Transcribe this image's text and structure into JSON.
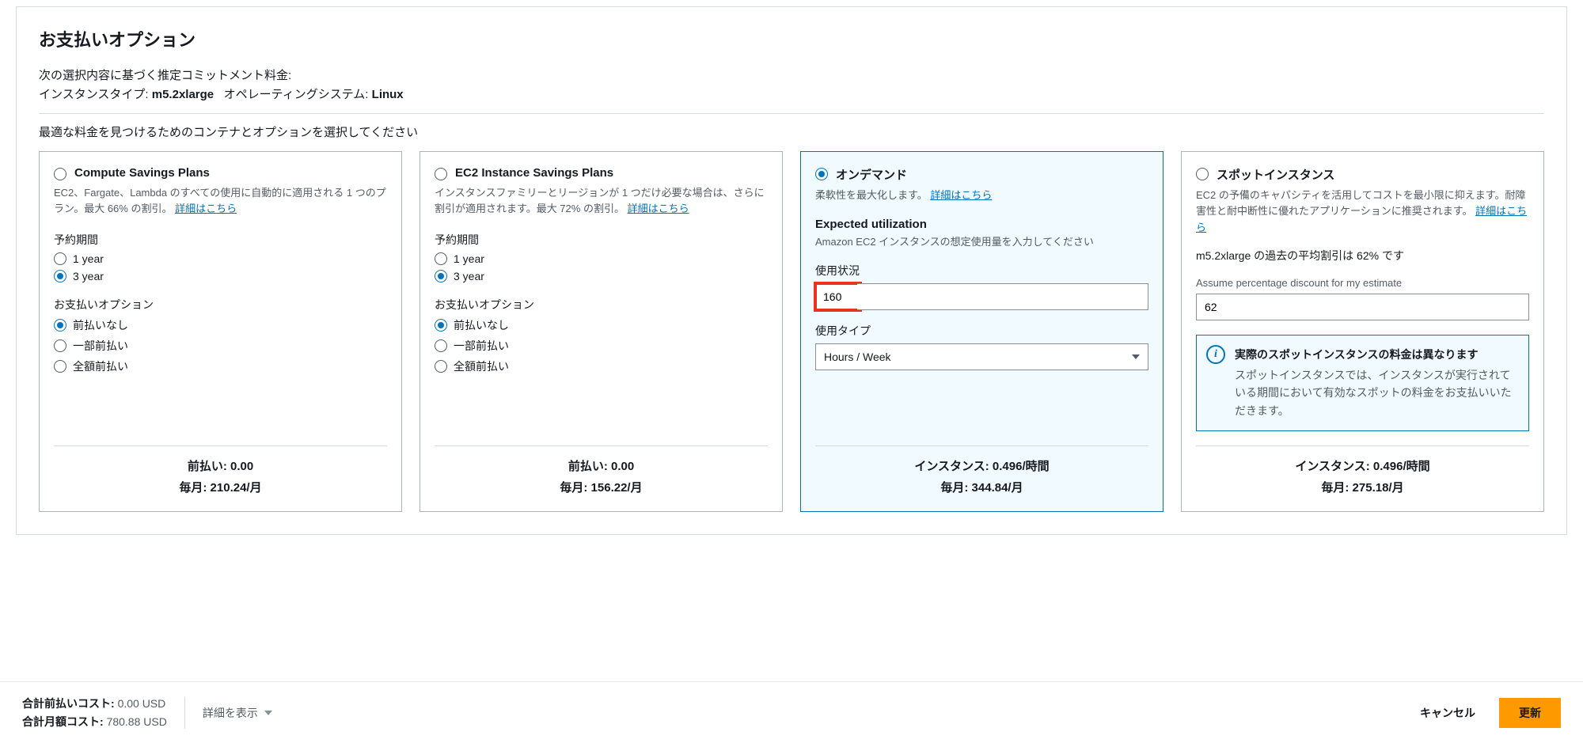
{
  "panel": {
    "title": "お支払いオプション",
    "summary_intro": "次の選択内容に基づく推定コミットメント料金:",
    "summary_instance_label": "インスタンスタイプ:",
    "summary_instance_value": "m5.2xlarge",
    "summary_os_label": "オペレーティングシステム:",
    "summary_os_value": "Linux",
    "help": "最適な料金を見つけるためのコンテナとオプションを選択してください"
  },
  "cards": {
    "csp": {
      "title": "Compute Savings Plans",
      "desc": "EC2、Fargate、Lambda のすべての使用に自動的に適用される 1 つのプラン。最大 66% の割引。",
      "link": "詳細はこちら",
      "term_label": "予約期間",
      "term_1": "1 year",
      "term_3": "3 year",
      "pay_label": "お支払いオプション",
      "pay_none": "前払いなし",
      "pay_partial": "一部前払い",
      "pay_full": "全額前払い",
      "upfront": "前払い: 0.00",
      "monthly": "毎月: 210.24/月"
    },
    "ec2sp": {
      "title": "EC2 Instance Savings Plans",
      "desc": "インスタンスファミリーとリージョンが 1 つだけ必要な場合は、さらに割引が適用されます。最大 72% の割引。",
      "link": "詳細はこちら",
      "term_label": "予約期間",
      "term_1": "1 year",
      "term_3": "3 year",
      "pay_label": "お支払いオプション",
      "pay_none": "前払いなし",
      "pay_partial": "一部前払い",
      "pay_full": "全額前払い",
      "upfront": "前払い: 0.00",
      "monthly": "毎月: 156.22/月"
    },
    "ondemand": {
      "title": "オンデマンド",
      "desc": "柔軟性を最大化します。",
      "link": "詳細はこちら",
      "expected_title": "Expected utilization",
      "expected_desc": "Amazon EC2 インスタンスの想定使用量を入力してください",
      "usage_label": "使用状況",
      "usage_value": "160",
      "type_label": "使用タイプ",
      "type_value": "Hours / Week",
      "instance": "インスタンス: 0.496/時間",
      "monthly": "毎月: 344.84/月"
    },
    "spot": {
      "title": "スポットインスタンス",
      "desc": "EC2 の予備のキャパシティを活用してコストを最小限に抑えます。耐障害性と耐中断性に優れたアプリケーションに推奨されます。",
      "link": "詳細はこちら",
      "discount_text": "m5.2xlarge の過去の平均割引は 62% です",
      "assume_label": "Assume percentage discount for my estimate",
      "assume_value": "62",
      "info_title": "実際のスポットインスタンスの料金は異なります",
      "info_body": "スポットインスタンスでは、インスタンスが実行されている期間において有効なスポットの料金をお支払いいただきます。",
      "instance": "インスタンス: 0.496/時間",
      "monthly": "毎月: 275.18/月"
    }
  },
  "footer": {
    "upfront_label": "合計前払いコスト:",
    "upfront_value": "0.00 USD",
    "monthly_label": "合計月額コスト:",
    "monthly_value": "780.88 USD",
    "details": "詳細を表示",
    "cancel": "キャンセル",
    "update": "更新"
  }
}
